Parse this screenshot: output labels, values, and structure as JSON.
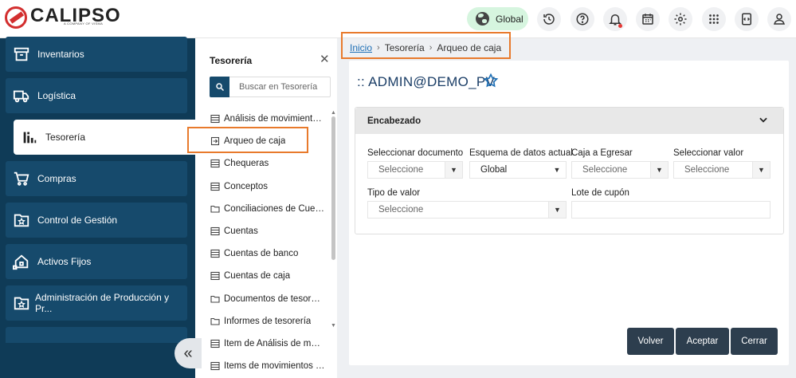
{
  "brand": {
    "name": "CALIPSO",
    "tagline": "A COMPANY OF VISMA"
  },
  "topbar": {
    "scope_label": "Global",
    "icons": [
      "history-icon",
      "help-icon",
      "bell-icon",
      "calendar-icon",
      "gear-icon",
      "apps-grid-icon",
      "code-file-icon",
      "user-icon"
    ],
    "notification_dot_color": "#e53935"
  },
  "sidebar": {
    "items": [
      {
        "label": "Inventarios",
        "icon": "inventory-box-icon"
      },
      {
        "label": "Logística",
        "icon": "truck-icon"
      },
      {
        "label": "Tesorería",
        "icon": "treasury-chart-icon",
        "active": true
      },
      {
        "label": "Compras",
        "icon": "cart-icon"
      },
      {
        "label": "Control de Gestión",
        "icon": "star-box-icon"
      },
      {
        "label": "Activos Fijos",
        "icon": "house-hand-icon"
      },
      {
        "label": "Administración de Producción y Pr...",
        "icon": "star-box-icon"
      }
    ],
    "collapse_symbol": "«"
  },
  "subpanel": {
    "title": "Tesorería",
    "search_placeholder": "Buscar en Tesorería",
    "items": [
      {
        "label": "Análisis de movimientos ...",
        "icon": "list-icon"
      },
      {
        "label": "Arqueo de caja",
        "icon": "entry-icon",
        "highlighted": true
      },
      {
        "label": "Chequeras",
        "icon": "list-icon"
      },
      {
        "label": "Conceptos",
        "icon": "list-icon"
      },
      {
        "label": "Conciliaciones de Cuentas",
        "icon": "folder-icon"
      },
      {
        "label": "Cuentas",
        "icon": "list-icon"
      },
      {
        "label": "Cuentas de banco",
        "icon": "list-icon"
      },
      {
        "label": "Cuentas de caja",
        "icon": "list-icon"
      },
      {
        "label": "Documentos de tesorería",
        "icon": "folder-icon"
      },
      {
        "label": "Informes de tesorería",
        "icon": "folder-icon"
      },
      {
        "label": "Item de Análisis de movi...",
        "icon": "list-icon"
      },
      {
        "label": "Items de movimientos de...",
        "icon": "list-icon"
      }
    ]
  },
  "breadcrumb": {
    "home": "Inicio",
    "section": "Tesorería",
    "current": "Arqueo de caja",
    "separator": "›"
  },
  "page": {
    "title": ":: ADMIN@DEMO_PV",
    "section_title": "Encabezado",
    "fields": {
      "documento": {
        "label": "Seleccionar documento",
        "value": "Seleccione"
      },
      "esquema": {
        "label": "Esquema de datos actual",
        "value": "Global"
      },
      "caja": {
        "label": "Caja a Egresar",
        "value": "Seleccione"
      },
      "valor": {
        "label": "Seleccionar valor",
        "value": "Seleccione"
      },
      "tipo": {
        "label": "Tipo de valor",
        "value": "Seleccione"
      },
      "lote": {
        "label": "Lote de cupón",
        "value": ""
      }
    },
    "buttons": {
      "back": "Volver",
      "accept": "Aceptar",
      "close": "Cerrar"
    }
  },
  "colors": {
    "sidebar_bg": "#0f3b57",
    "highlight": "#e87a2c",
    "button_bg": "#2d3e4e",
    "accent_link": "#1e6fb5"
  }
}
